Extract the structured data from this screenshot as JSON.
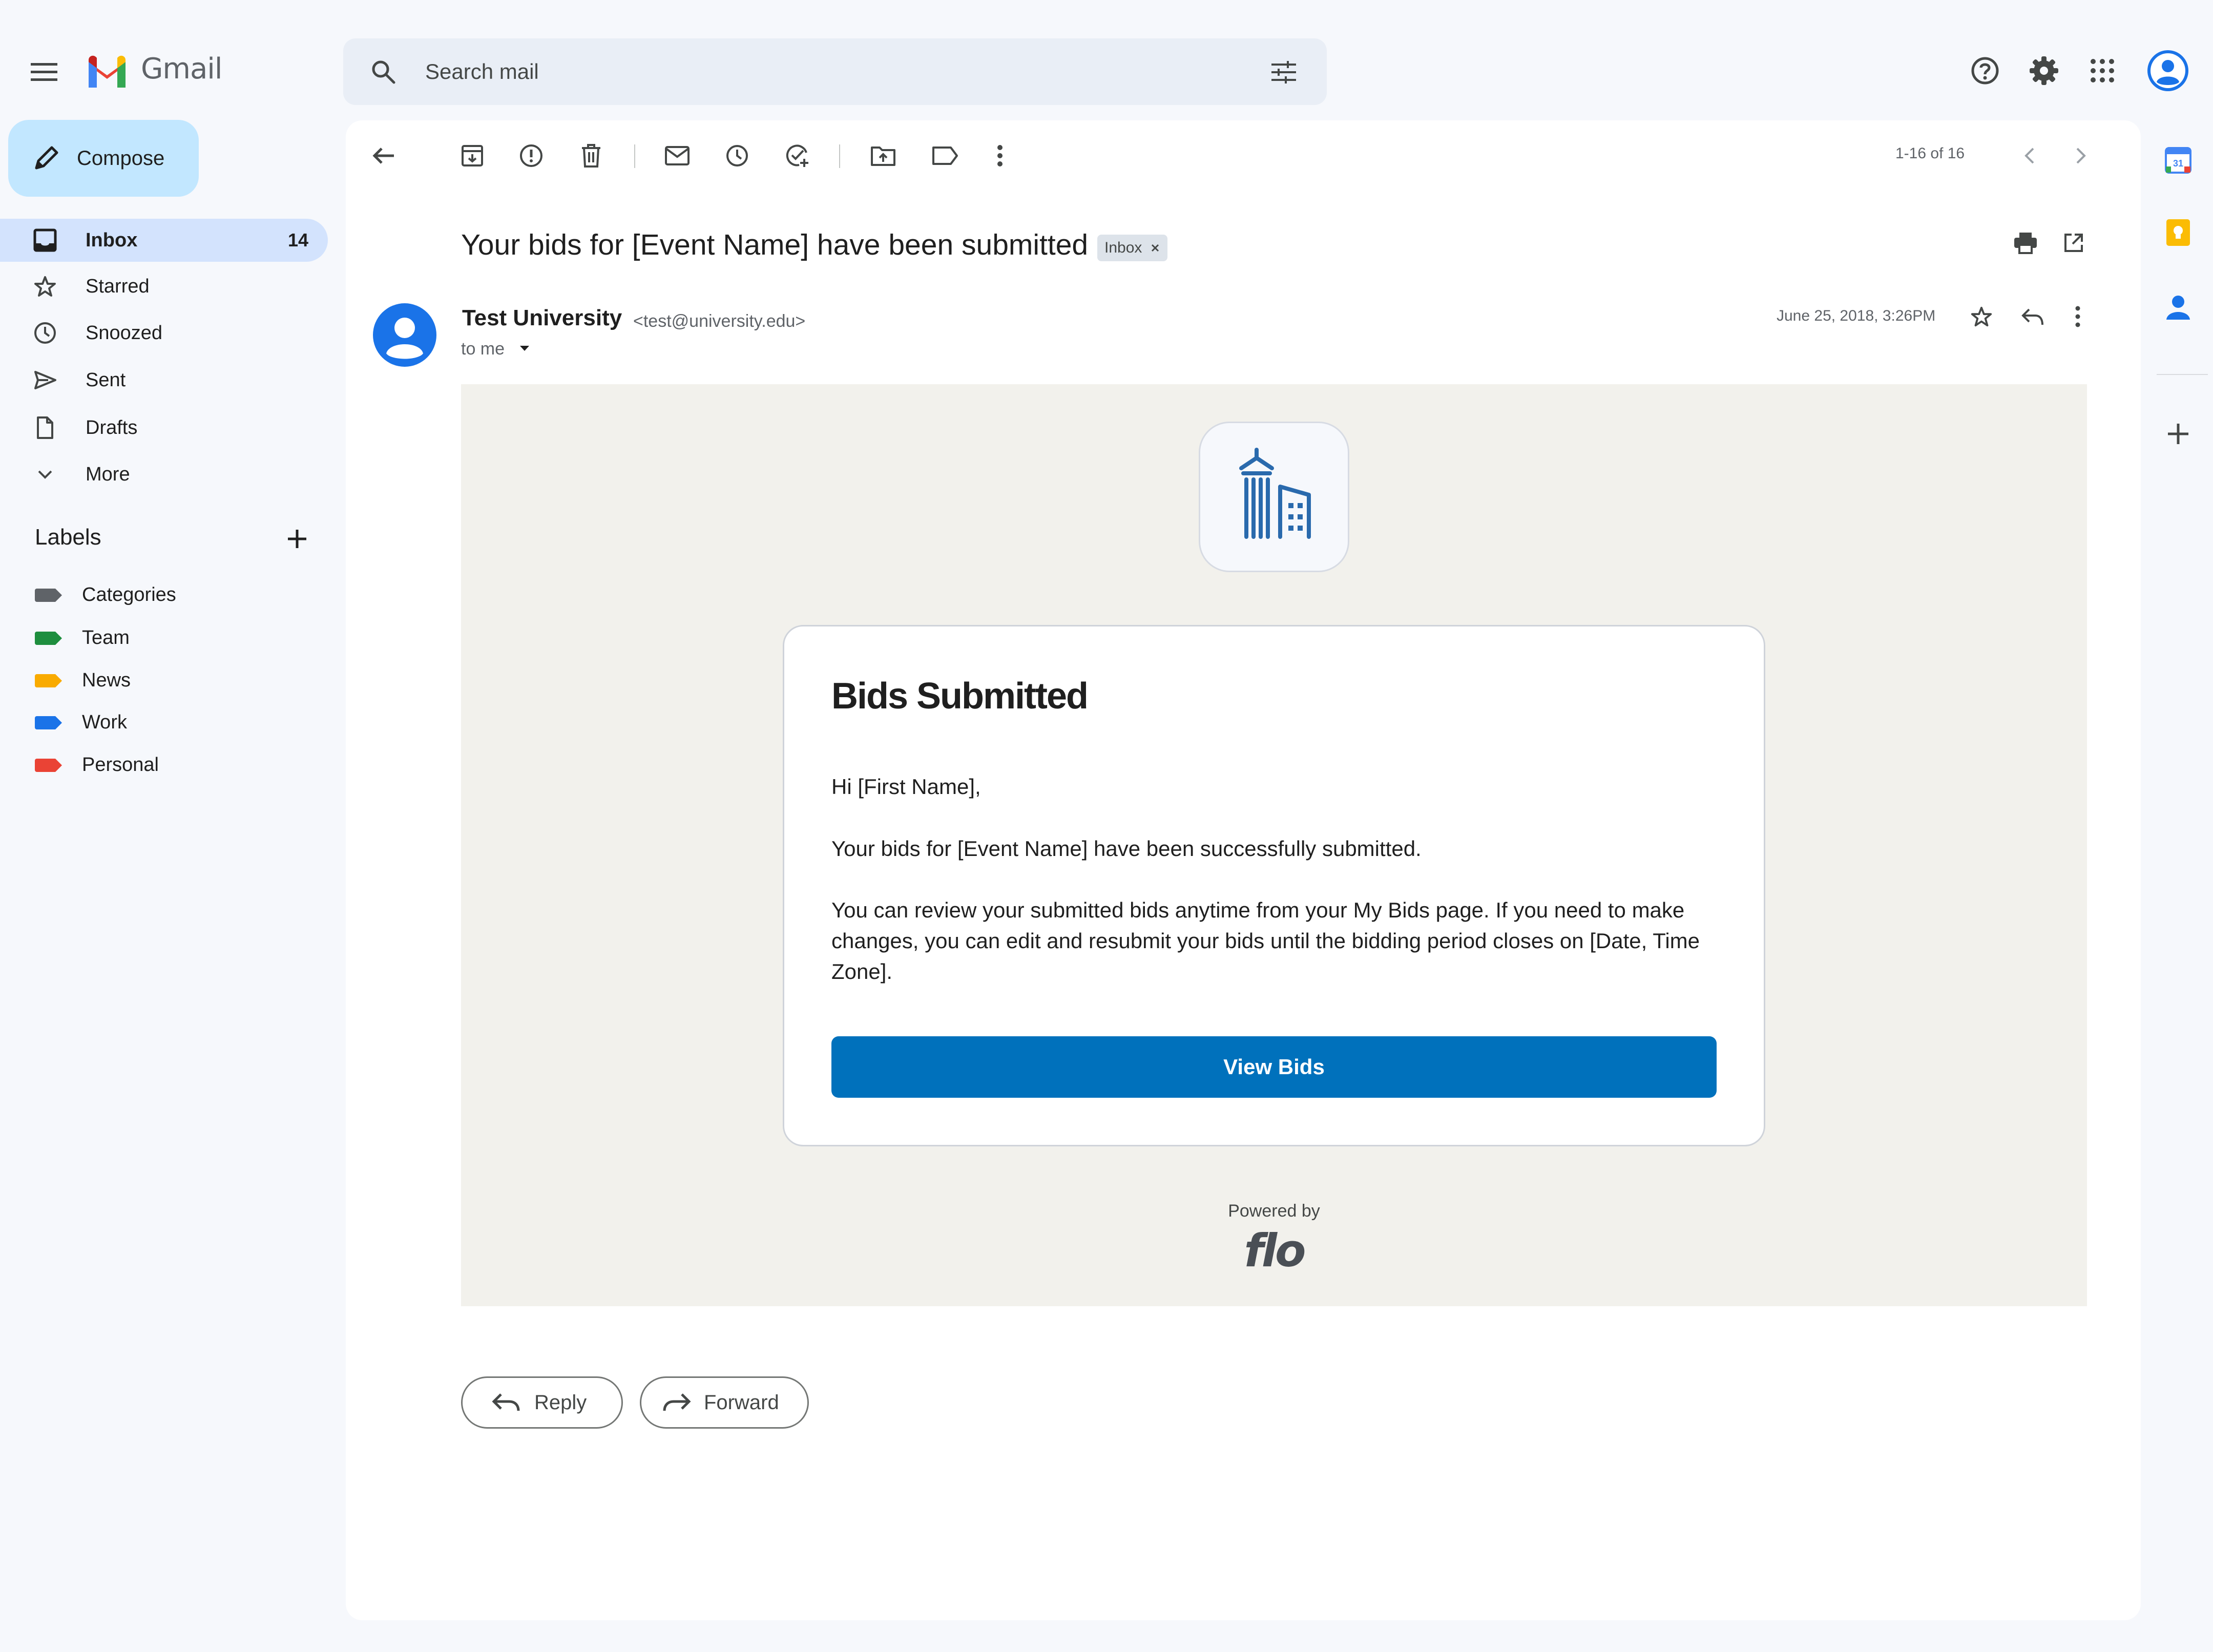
{
  "app": {
    "name": "Gmail",
    "search_placeholder": "Search mail"
  },
  "sidebar": {
    "compose_label": "Compose",
    "items": [
      {
        "label": "Inbox",
        "count": "14",
        "icon": "inbox-icon",
        "active": true
      },
      {
        "label": "Starred",
        "icon": "star-icon"
      },
      {
        "label": "Snoozed",
        "icon": "clock-icon"
      },
      {
        "label": "Sent",
        "icon": "send-icon"
      },
      {
        "label": "Drafts",
        "icon": "draft-icon"
      },
      {
        "label": "More",
        "icon": "chevron-down-icon"
      }
    ],
    "labels_title": "Labels",
    "labels": [
      {
        "label": "Categories",
        "color": "#5f6368"
      },
      {
        "label": "Team",
        "color": "#1e8e3e"
      },
      {
        "label": "News",
        "color": "#f9ab00"
      },
      {
        "label": "Work",
        "color": "#1a73e8"
      },
      {
        "label": "Personal",
        "color": "#ea4335"
      }
    ]
  },
  "toolbar": {
    "pager": "1-16 of 16",
    "icons": [
      "back-arrow-icon",
      "archive-icon",
      "report-spam-icon",
      "delete-icon",
      "mark-unread-icon",
      "snooze-icon",
      "add-task-icon",
      "move-to-icon",
      "label-icon",
      "more-vert-icon",
      "chevron-left-icon",
      "chevron-right-icon"
    ]
  },
  "message": {
    "subject": "Your bids for [Event Name] have been submitted",
    "chip": "Inbox",
    "sender_name": "Test University",
    "sender_email": "<test@university.edu>",
    "to": "to me",
    "date": "June 25, 2018, 3:26PM"
  },
  "email": {
    "title": "Bids Submitted",
    "greeting": "Hi [First Name],",
    "para1": "Your bids for [Event Name] have been successfully submitted.",
    "para2": "You can review your submitted bids anytime from your My Bids page. If you need to make changes, you can edit and resubmit your bids until the bidding period closes on [Date, Time Zone].",
    "cta": "View Bids",
    "powered_by": "Powered by",
    "brand": "flo"
  },
  "actions": {
    "reply": "Reply",
    "forward": "Forward"
  },
  "colors": {
    "cta": "#0071bc",
    "active_nav": "#d3e3fd",
    "compose": "#c2e7ff",
    "email_bg": "#f2f1ec"
  }
}
